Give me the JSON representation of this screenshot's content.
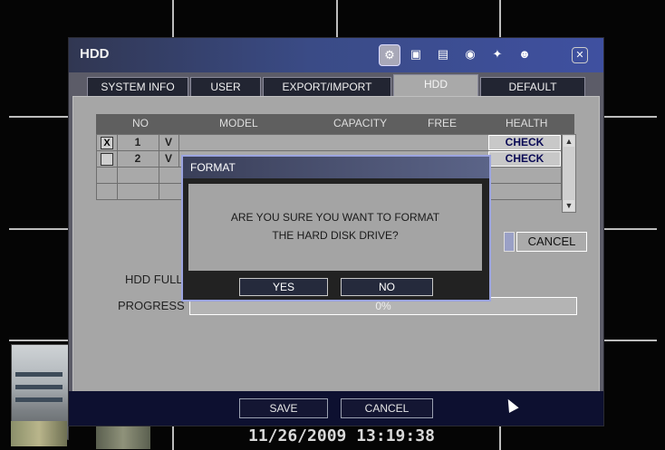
{
  "window": {
    "title": "HDD",
    "toolbar_icons": [
      "gear-icon",
      "camera-icon",
      "record-icon",
      "network-icon",
      "event-icon",
      "user-icon",
      "close-icon"
    ]
  },
  "tabs": [
    "SYSTEM INFO",
    "USER",
    "EXPORT/IMPORT",
    "HDD",
    "DEFAULT"
  ],
  "active_tab": "HDD",
  "table": {
    "headers": [
      "NO",
      "MODEL",
      "CAPACITY",
      "FREE",
      "HEALTH"
    ],
    "rows": [
      {
        "checked": "X",
        "no": "1",
        "model": "V",
        "health": "CHECK"
      },
      {
        "checked": "",
        "no": "2",
        "model": "V",
        "health": "CHECK"
      }
    ]
  },
  "labels": {
    "hdd_full": "HDD FULL",
    "progress": "PROGRESS",
    "progress_value": "0%"
  },
  "buttons": {
    "cancel_format": "CANCEL",
    "save": "SAVE",
    "cancel": "CANCEL"
  },
  "format_dialog": {
    "title": "FORMAT",
    "message_line1": "ARE YOU SURE YOU WANT TO FORMAT",
    "message_line2": "THE HARD DISK DRIVE?",
    "yes": "YES",
    "no": "NO"
  },
  "osd": {
    "timestamp": "11/26/2009 13:19:38"
  }
}
